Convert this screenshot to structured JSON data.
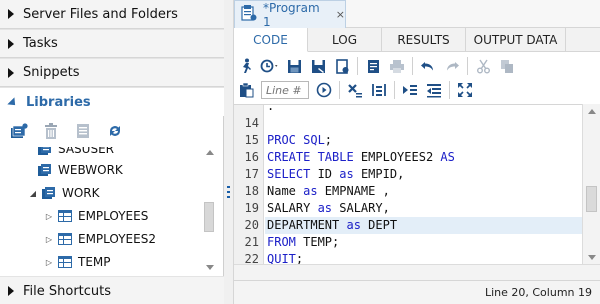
{
  "nav": {
    "sections": {
      "server_files": "Server Files and Folders",
      "tasks": "Tasks",
      "snippets": "Snippets",
      "libraries": "Libraries",
      "file_shortcuts": "File Shortcuts"
    },
    "tree": {
      "partial_top": "SASUSER",
      "webwork": "WEBWORK",
      "work": "WORK",
      "tables": [
        "EMPLOYEES",
        "EMPLOYEES2",
        "TEMP"
      ]
    }
  },
  "editor": {
    "tab_title": "*Program 1",
    "tab_close": "×",
    "subtabs": [
      "CODE",
      "LOG",
      "RESULTS",
      "OUTPUT DATA"
    ],
    "active_subtab": "CODE",
    "line_input_placeholder": "Line #",
    "lines": [
      {
        "n": "",
        "text": "."
      },
      {
        "n": "14",
        "text": ""
      },
      {
        "n": "15",
        "text": "PROC SQL;"
      },
      {
        "n": "16",
        "text": "CREATE TABLE EMPLOYEES2 AS"
      },
      {
        "n": "17",
        "text": "SELECT ID as EMPID,"
      },
      {
        "n": "18",
        "text": "Name as EMPNAME ,"
      },
      {
        "n": "19",
        "text": "SALARY as SALARY,"
      },
      {
        "n": "20",
        "text": "DEPARTMENT as DEPT"
      },
      {
        "n": "21",
        "text": "FROM TEMP;"
      },
      {
        "n": "22",
        "text": "QUIT;"
      }
    ],
    "highlighted_line": "20",
    "status": "Line 20, Column 19"
  },
  "colors": {
    "accent": "#2d6aa8",
    "keyword": "#1c20c8",
    "highlight_line": "#e3eef8"
  }
}
